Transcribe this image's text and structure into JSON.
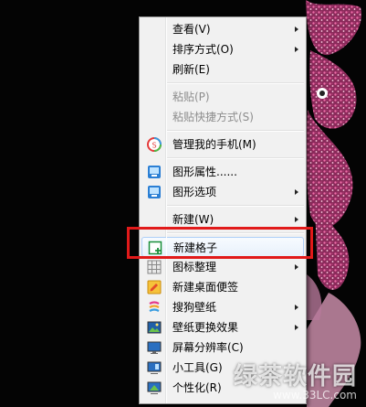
{
  "menu": {
    "items": [
      {
        "label": "查看(V)",
        "submenu": true
      },
      {
        "label": "排序方式(O)",
        "submenu": true
      },
      {
        "label": "刷新(E)"
      },
      {
        "label": "粘贴(P)",
        "disabled": true
      },
      {
        "label": "粘贴快捷方式(S)",
        "disabled": true
      },
      {
        "label": "管理我的手机(M)",
        "icon": "phone-manager-icon"
      },
      {
        "label": "图形属性......",
        "icon": "graphics-properties-icon"
      },
      {
        "label": "图形选项",
        "icon": "graphics-options-icon",
        "submenu": true
      },
      {
        "label": "新建(W)",
        "submenu": true
      },
      {
        "label": "新建格子",
        "icon": "new-grid-icon",
        "highlighted": true
      },
      {
        "label": "图标整理",
        "icon": "icon-organize-icon",
        "submenu": true
      },
      {
        "label": "新建桌面便签",
        "icon": "desktop-note-icon"
      },
      {
        "label": "搜狗壁纸",
        "icon": "sogou-wallpaper-icon",
        "submenu": true
      },
      {
        "label": "壁纸更换效果",
        "icon": "wallpaper-effect-icon",
        "submenu": true
      },
      {
        "label": "屏幕分辨率(C)",
        "icon": "screen-resolution-icon"
      },
      {
        "label": "小工具(G)",
        "icon": "gadgets-icon"
      },
      {
        "label": "个性化(R)",
        "icon": "personalize-icon"
      }
    ]
  },
  "watermark": {
    "title": "绿茶软件园",
    "url": "www.33LC.com"
  },
  "colors": {
    "highlight_box": "#e11a1a",
    "menu_bg": "#f1f1f1"
  }
}
